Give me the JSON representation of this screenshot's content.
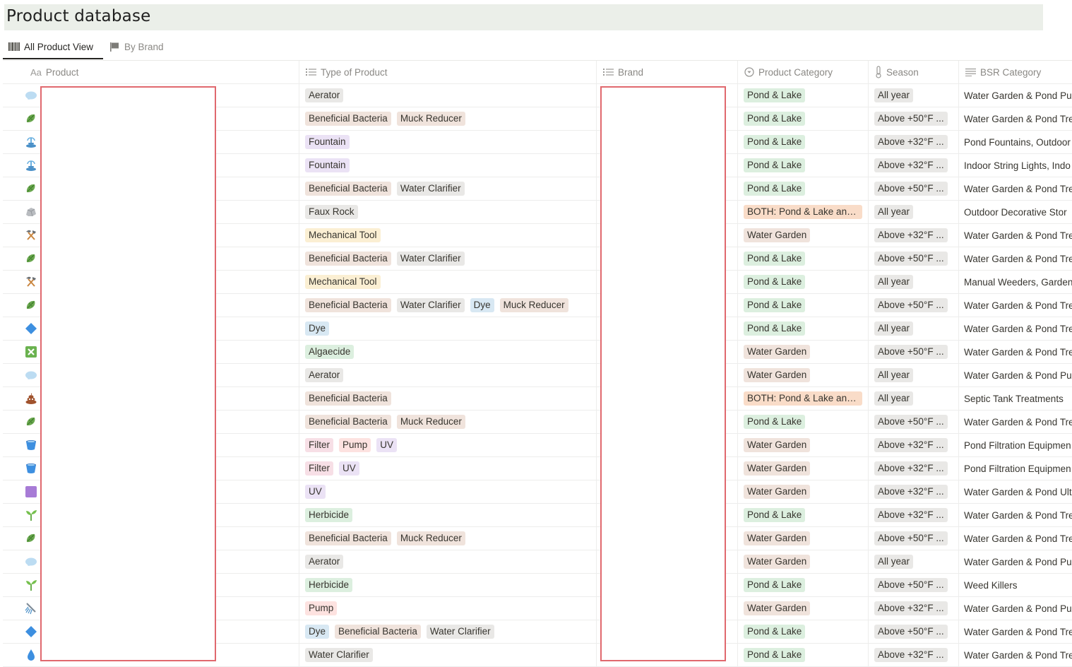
{
  "page": {
    "title": "Product database"
  },
  "views": [
    {
      "label": "All Product View",
      "icon": "barcode-icon",
      "active": true
    },
    {
      "label": "By Brand",
      "icon": "flag-icon",
      "active": false
    }
  ],
  "columns": [
    {
      "label": "Product",
      "icon": "title-aa-icon"
    },
    {
      "label": "Type of Product",
      "icon": "multi-select-list-icon"
    },
    {
      "label": "Brand",
      "icon": "multi-select-list-icon"
    },
    {
      "label": "Product Category",
      "icon": "select-circle-icon"
    },
    {
      "label": "Season",
      "icon": "thermometer-icon"
    },
    {
      "label": "BSR Category",
      "icon": "text-lines-icon"
    }
  ],
  "colors": {
    "gray_tag": "#e9e8e6",
    "brown_tag": "#f0e3dc",
    "purple_tag": "#ebe2f5",
    "yellow_tag": "#fbefd3",
    "blue_tag": "#d8e8f3",
    "green_tag": "#dcefdf",
    "pink_tag": "#f7dfe6",
    "red_tag": "#fde2e0",
    "orange_tag": "#f9dcc8",
    "redaction_border": "#e0686e"
  },
  "rows": [
    {
      "icon": "cloud-icon",
      "types": [
        [
          "Aerator",
          "gray"
        ]
      ],
      "category": [
        "Pond & Lake",
        "green"
      ],
      "season": "All year",
      "bsr": "Water Garden & Pond Pu"
    },
    {
      "icon": "microbe-icon",
      "types": [
        [
          "Beneficial Bacteria",
          "brown"
        ],
        [
          "Muck Reducer",
          "brown"
        ]
      ],
      "category": [
        "Pond & Lake",
        "green"
      ],
      "season": "Above +50°F ...",
      "bsr": "Water Garden & Pond Tre"
    },
    {
      "icon": "fountain-icon",
      "types": [
        [
          "Fountain",
          "purple"
        ]
      ],
      "category": [
        "Pond & Lake",
        "green"
      ],
      "season": "Above +32°F ...",
      "bsr": "Pond Fountains, Outdoor"
    },
    {
      "icon": "fountain-icon",
      "types": [
        [
          "Fountain",
          "purple"
        ]
      ],
      "category": [
        "Pond & Lake",
        "green"
      ],
      "season": "Above +32°F ...",
      "bsr": "Indoor String Lights, Indo"
    },
    {
      "icon": "microbe-icon",
      "types": [
        [
          "Beneficial Bacteria",
          "brown"
        ],
        [
          "Water Clarifier",
          "gray"
        ]
      ],
      "category": [
        "Pond & Lake",
        "green"
      ],
      "season": "Above +50°F ...",
      "bsr": "Water Garden & Pond Tre"
    },
    {
      "icon": "rock-icon",
      "types": [
        [
          "Faux Rock",
          "gray"
        ]
      ],
      "category": [
        "BOTH: Pond & Lake and...",
        "orange"
      ],
      "season": "All year",
      "bsr": "Outdoor Decorative Stor"
    },
    {
      "icon": "hammer-pick-icon",
      "types": [
        [
          "Mechanical Tool",
          "yellow"
        ]
      ],
      "category": [
        "Water Garden",
        "brown"
      ],
      "season": "Above +32°F ...",
      "bsr": "Water Garden & Pond Tre"
    },
    {
      "icon": "microbe-icon",
      "types": [
        [
          "Beneficial Bacteria",
          "brown"
        ],
        [
          "Water Clarifier",
          "gray"
        ]
      ],
      "category": [
        "Pond & Lake",
        "green"
      ],
      "season": "Above +50°F ...",
      "bsr": "Water Garden & Pond Tre"
    },
    {
      "icon": "hammer-pick-icon",
      "types": [
        [
          "Mechanical Tool",
          "yellow"
        ]
      ],
      "category": [
        "Pond & Lake",
        "green"
      ],
      "season": "All year",
      "bsr": "Manual Weeders, Garden"
    },
    {
      "icon": "microbe-icon",
      "types": [
        [
          "Beneficial Bacteria",
          "brown"
        ],
        [
          "Water Clarifier",
          "gray"
        ],
        [
          "Dye",
          "blue"
        ],
        [
          "Muck Reducer",
          "brown"
        ]
      ],
      "category": [
        "Pond & Lake",
        "green"
      ],
      "season": "Above +50°F ...",
      "bsr": "Water Garden & Pond Tre"
    },
    {
      "icon": "blue-diamond-icon",
      "types": [
        [
          "Dye",
          "blue"
        ]
      ],
      "category": [
        "Pond & Lake",
        "green"
      ],
      "season": "All year",
      "bsr": "Water Garden & Pond Tre"
    },
    {
      "icon": "cross-box-icon",
      "types": [
        [
          "Algaecide",
          "green"
        ]
      ],
      "category": [
        "Water Garden",
        "brown"
      ],
      "season": "Above +50°F ...",
      "bsr": "Water Garden & Pond Tre"
    },
    {
      "icon": "cloud-icon",
      "types": [
        [
          "Aerator",
          "gray"
        ]
      ],
      "category": [
        "Water Garden",
        "brown"
      ],
      "season": "All year",
      "bsr": "Water Garden & Pond Pu"
    },
    {
      "icon": "poop-icon",
      "types": [
        [
          "Beneficial Bacteria",
          "brown"
        ]
      ],
      "category": [
        "BOTH: Pond & Lake and...",
        "orange"
      ],
      "season": "All year",
      "bsr": "Septic Tank Treatments"
    },
    {
      "icon": "microbe-icon",
      "types": [
        [
          "Beneficial Bacteria",
          "brown"
        ],
        [
          "Muck Reducer",
          "brown"
        ]
      ],
      "category": [
        "Pond & Lake",
        "green"
      ],
      "season": "Above +50°F ...",
      "bsr": "Water Garden & Pond Tre"
    },
    {
      "icon": "bucket-icon",
      "types": [
        [
          "Filter",
          "pink"
        ],
        [
          "Pump",
          "red"
        ],
        [
          "UV",
          "purple"
        ]
      ],
      "category": [
        "Water Garden",
        "brown"
      ],
      "season": "Above +32°F ...",
      "bsr": "Pond Filtration Equipmen"
    },
    {
      "icon": "bucket-icon",
      "types": [
        [
          "Filter",
          "pink"
        ],
        [
          "UV",
          "purple"
        ]
      ],
      "category": [
        "Water Garden",
        "brown"
      ],
      "season": "Above +32°F ...",
      "bsr": "Pond Filtration Equipmen"
    },
    {
      "icon": "purple-square-icon",
      "types": [
        [
          "UV",
          "purple"
        ]
      ],
      "category": [
        "Water Garden",
        "brown"
      ],
      "season": "Above +32°F ...",
      "bsr": "Water Garden & Pond Ult"
    },
    {
      "icon": "seedling-icon",
      "types": [
        [
          "Herbicide",
          "green"
        ]
      ],
      "category": [
        "Pond & Lake",
        "green"
      ],
      "season": "Above +32°F ...",
      "bsr": "Water Garden & Pond Tre"
    },
    {
      "icon": "microbe-icon",
      "types": [
        [
          "Beneficial Bacteria",
          "brown"
        ],
        [
          "Muck Reducer",
          "brown"
        ]
      ],
      "category": [
        "Water Garden",
        "brown"
      ],
      "season": "Above +50°F ...",
      "bsr": "Water Garden & Pond Tre"
    },
    {
      "icon": "cloud-icon",
      "types": [
        [
          "Aerator",
          "gray"
        ]
      ],
      "category": [
        "Water Garden",
        "brown"
      ],
      "season": "All year",
      "bsr": "Water Garden & Pond Pu"
    },
    {
      "icon": "seedling-icon",
      "types": [
        [
          "Herbicide",
          "green"
        ]
      ],
      "category": [
        "Pond & Lake",
        "green"
      ],
      "season": "Above +50°F ...",
      "bsr": "Weed Killers"
    },
    {
      "icon": "shower-icon",
      "types": [
        [
          "Pump",
          "red"
        ]
      ],
      "category": [
        "Water Garden",
        "brown"
      ],
      "season": "Above +32°F ...",
      "bsr": "Water Garden & Pond Pu"
    },
    {
      "icon": "blue-diamond-icon",
      "types": [
        [
          "Dye",
          "blue"
        ],
        [
          "Beneficial Bacteria",
          "brown"
        ],
        [
          "Water Clarifier",
          "gray"
        ]
      ],
      "category": [
        "Pond & Lake",
        "green"
      ],
      "season": "Above +50°F ...",
      "bsr": "Water Garden & Pond Tre"
    },
    {
      "icon": "droplet-icon",
      "types": [
        [
          "Water Clarifier",
          "gray"
        ]
      ],
      "category": [
        "Pond & Lake",
        "green"
      ],
      "season": "Above +32°F ...",
      "bsr": "Water Garden & Pond Tre"
    }
  ]
}
